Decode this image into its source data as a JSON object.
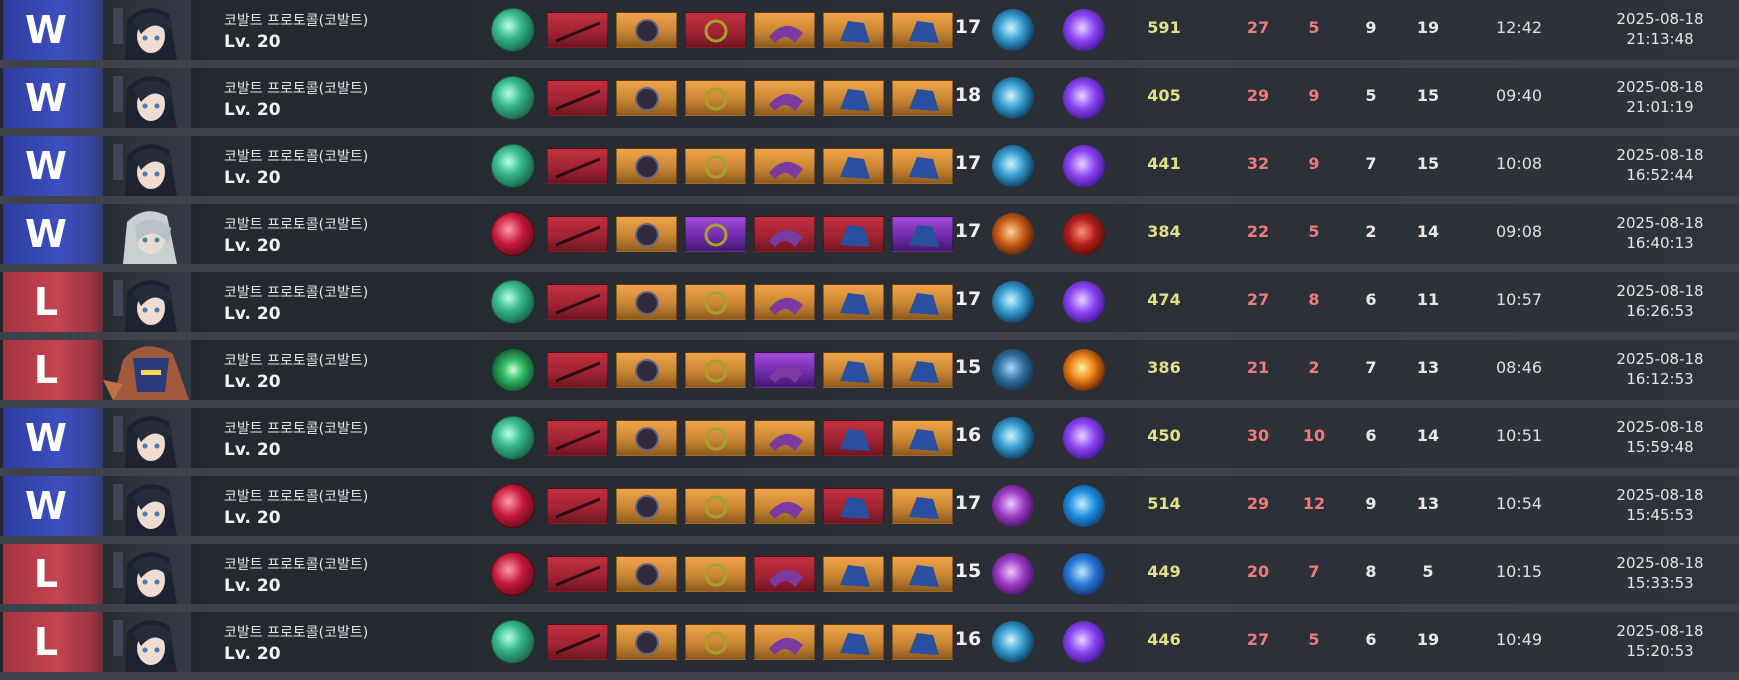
{
  "colors": {
    "win": "#3d4fc0",
    "loss": "#c44450",
    "score": "#e3e089",
    "kill_death": "#f07b7b"
  },
  "matches": [
    {
      "result": "W",
      "champion": "코발트 프로토콜(코발트)",
      "level": "Lv. 20",
      "hero": "dark-hair",
      "skill": "teal",
      "items": [
        "red",
        "orange",
        "red",
        "orange",
        "orange",
        "orange"
      ],
      "char_level": "17",
      "spell1": "blue-slash",
      "spell2": "purple-fist",
      "score": "591",
      "k": "27",
      "d": "5",
      "a": "9",
      "cs": "19",
      "time": "12:42",
      "date": "2025-08-18",
      "clock": "21:13:48"
    },
    {
      "result": "W",
      "champion": "코발트 프로토콜(코발트)",
      "level": "Lv. 20",
      "hero": "dark-hair",
      "skill": "teal",
      "items": [
        "red",
        "orange",
        "orange",
        "orange",
        "orange",
        "orange"
      ],
      "char_level": "18",
      "spell1": "blue-slash",
      "spell2": "purple-fist",
      "score": "405",
      "k": "29",
      "d": "9",
      "a": "5",
      "cs": "15",
      "time": "09:40",
      "date": "2025-08-18",
      "clock": "21:01:19"
    },
    {
      "result": "W",
      "champion": "코발트 프로토콜(코발트)",
      "level": "Lv. 20",
      "hero": "dark-hair",
      "skill": "teal",
      "items": [
        "red",
        "orange",
        "orange",
        "orange",
        "orange",
        "orange"
      ],
      "char_level": "17",
      "spell1": "blue-slash",
      "spell2": "purple-fist",
      "score": "441",
      "k": "32",
      "d": "9",
      "a": "7",
      "cs": "15",
      "time": "10:08",
      "date": "2025-08-18",
      "clock": "16:52:44"
    },
    {
      "result": "W",
      "champion": "코발트 프로토콜(코발트)",
      "level": "Lv. 20",
      "hero": "silver-hair",
      "skill": "crimson",
      "items": [
        "red",
        "orange",
        "purple",
        "red",
        "red",
        "purple"
      ],
      "char_level": "17",
      "spell1": "orange-blade",
      "spell2": "red-demon",
      "score": "384",
      "k": "22",
      "d": "5",
      "a": "2",
      "cs": "14",
      "time": "09:08",
      "date": "2025-08-18",
      "clock": "16:40:13"
    },
    {
      "result": "L",
      "champion": "코발트 프로토콜(코발트)",
      "level": "Lv. 20",
      "hero": "dark-hair",
      "skill": "teal",
      "items": [
        "red",
        "orange",
        "orange",
        "orange",
        "orange",
        "orange"
      ],
      "char_level": "17",
      "spell1": "blue-slash",
      "spell2": "purple-fist",
      "score": "474",
      "k": "27",
      "d": "8",
      "a": "6",
      "cs": "11",
      "time": "10:57",
      "date": "2025-08-18",
      "clock": "16:26:53"
    },
    {
      "result": "L",
      "champion": "코발트 프로토콜(코발트)",
      "level": "Lv. 20",
      "hero": "masked",
      "skill": "green-eye",
      "items": [
        "red",
        "orange",
        "orange",
        "purple",
        "orange",
        "orange"
      ],
      "char_level": "15",
      "spell1": "dark-armor",
      "spell2": "fire-burst",
      "score": "386",
      "k": "21",
      "d": "2",
      "a": "7",
      "cs": "13",
      "time": "08:46",
      "date": "2025-08-18",
      "clock": "16:12:53"
    },
    {
      "result": "W",
      "champion": "코발트 프로토콜(코발트)",
      "level": "Lv. 20",
      "hero": "dark-hair",
      "skill": "teal",
      "items": [
        "red",
        "orange",
        "orange",
        "orange",
        "red",
        "orange"
      ],
      "char_level": "16",
      "spell1": "blue-slash",
      "spell2": "purple-fist",
      "score": "450",
      "k": "30",
      "d": "10",
      "a": "6",
      "cs": "14",
      "time": "10:51",
      "date": "2025-08-18",
      "clock": "15:59:48"
    },
    {
      "result": "W",
      "champion": "코발트 프로토콜(코발트)",
      "level": "Lv. 20",
      "hero": "dark-hair",
      "skill": "crimson",
      "items": [
        "red",
        "orange",
        "orange",
        "orange",
        "red",
        "orange"
      ],
      "char_level": "17",
      "spell1": "purple-cross",
      "spell2": "blue-swirl",
      "score": "514",
      "k": "29",
      "d": "12",
      "a": "9",
      "cs": "13",
      "time": "10:54",
      "date": "2025-08-18",
      "clock": "15:45:53"
    },
    {
      "result": "L",
      "champion": "코발트 프로토콜(코발트)",
      "level": "Lv. 20",
      "hero": "dark-hair",
      "skill": "crimson",
      "items": [
        "red",
        "orange",
        "orange",
        "red",
        "orange",
        "orange"
      ],
      "char_level": "15",
      "spell1": "purple-cross",
      "spell2": "blue-hammer",
      "score": "449",
      "k": "20",
      "d": "7",
      "a": "8",
      "cs": "5",
      "time": "10:15",
      "date": "2025-08-18",
      "clock": "15:33:53"
    },
    {
      "result": "L",
      "champion": "코발트 프로토콜(코발트)",
      "level": "Lv. 20",
      "hero": "dark-hair",
      "skill": "teal",
      "items": [
        "red",
        "orange",
        "orange",
        "orange",
        "orange",
        "orange"
      ],
      "char_level": "16",
      "spell1": "blue-slash",
      "spell2": "purple-fist",
      "score": "446",
      "k": "27",
      "d": "5",
      "a": "6",
      "cs": "19",
      "time": "10:49",
      "date": "2025-08-18",
      "clock": "15:20:53"
    }
  ]
}
